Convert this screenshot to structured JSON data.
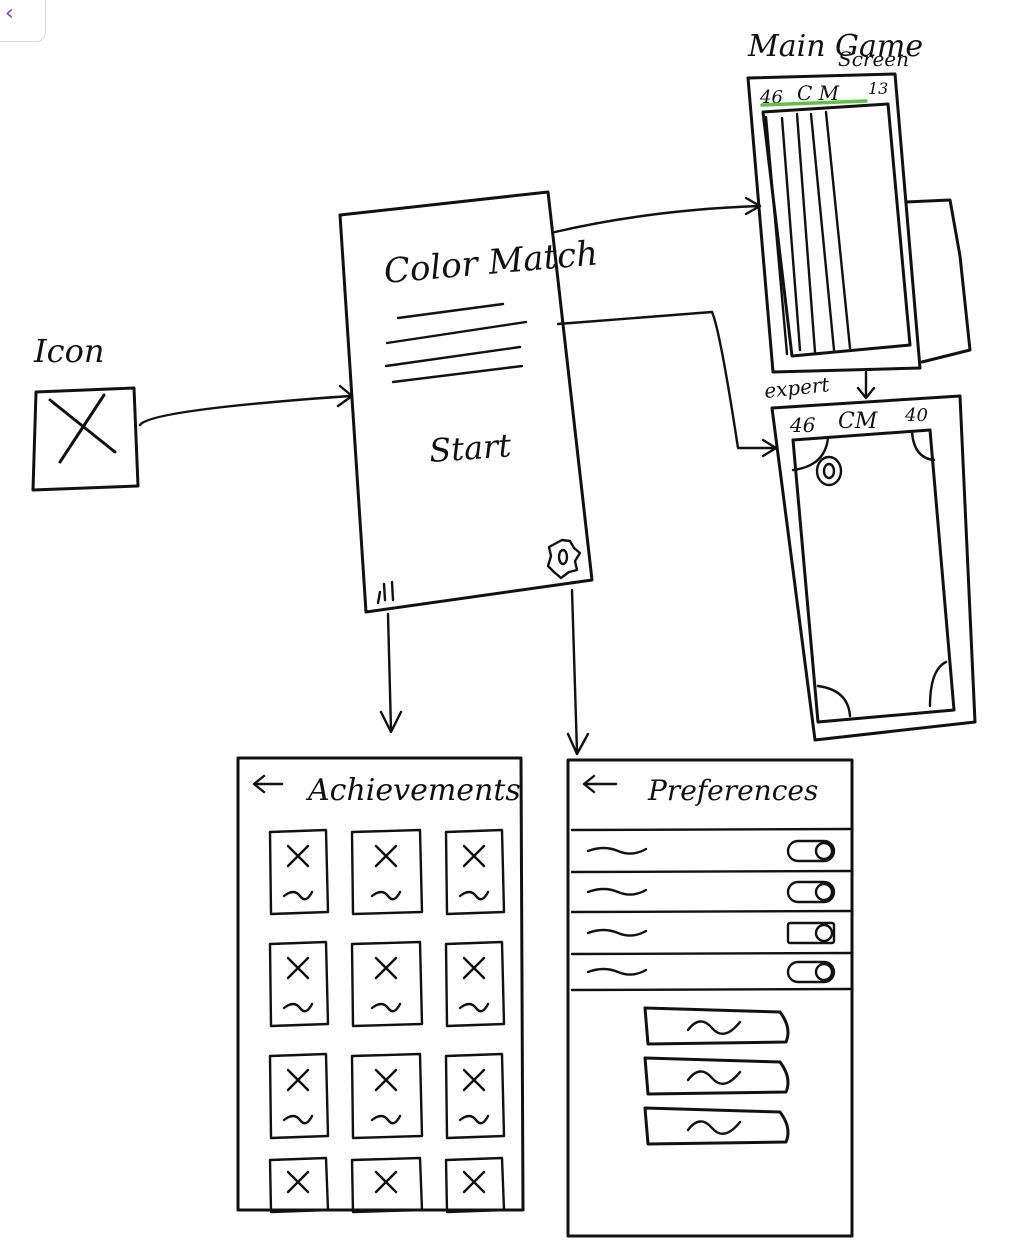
{
  "corner_tab": {
    "icon": "chevron-left-icon",
    "glyph": "‹"
  },
  "icon_box": {
    "label": "Icon"
  },
  "start_screen": {
    "title": "Color Match",
    "start_label": "Start",
    "settings_icon": "gear-icon",
    "stats_icon": "bar-chart-icon"
  },
  "main_game": {
    "label_line1": "Main Game",
    "label_line2": "Screen",
    "score_left": "46",
    "title_abbrev": "C M",
    "score_right": "13",
    "progress_color": "#5cc43a"
  },
  "expert_game": {
    "label": "expert",
    "score_left": "46",
    "title_abbrev": "CM",
    "score_right": "40",
    "target_icon": "target-icon"
  },
  "achievements": {
    "title": "Achievements",
    "back_icon": "back-arrow-icon"
  },
  "preferences": {
    "title": "Preferences",
    "back_icon": "back-arrow-icon",
    "toggle_count": 4,
    "button_count": 3
  }
}
